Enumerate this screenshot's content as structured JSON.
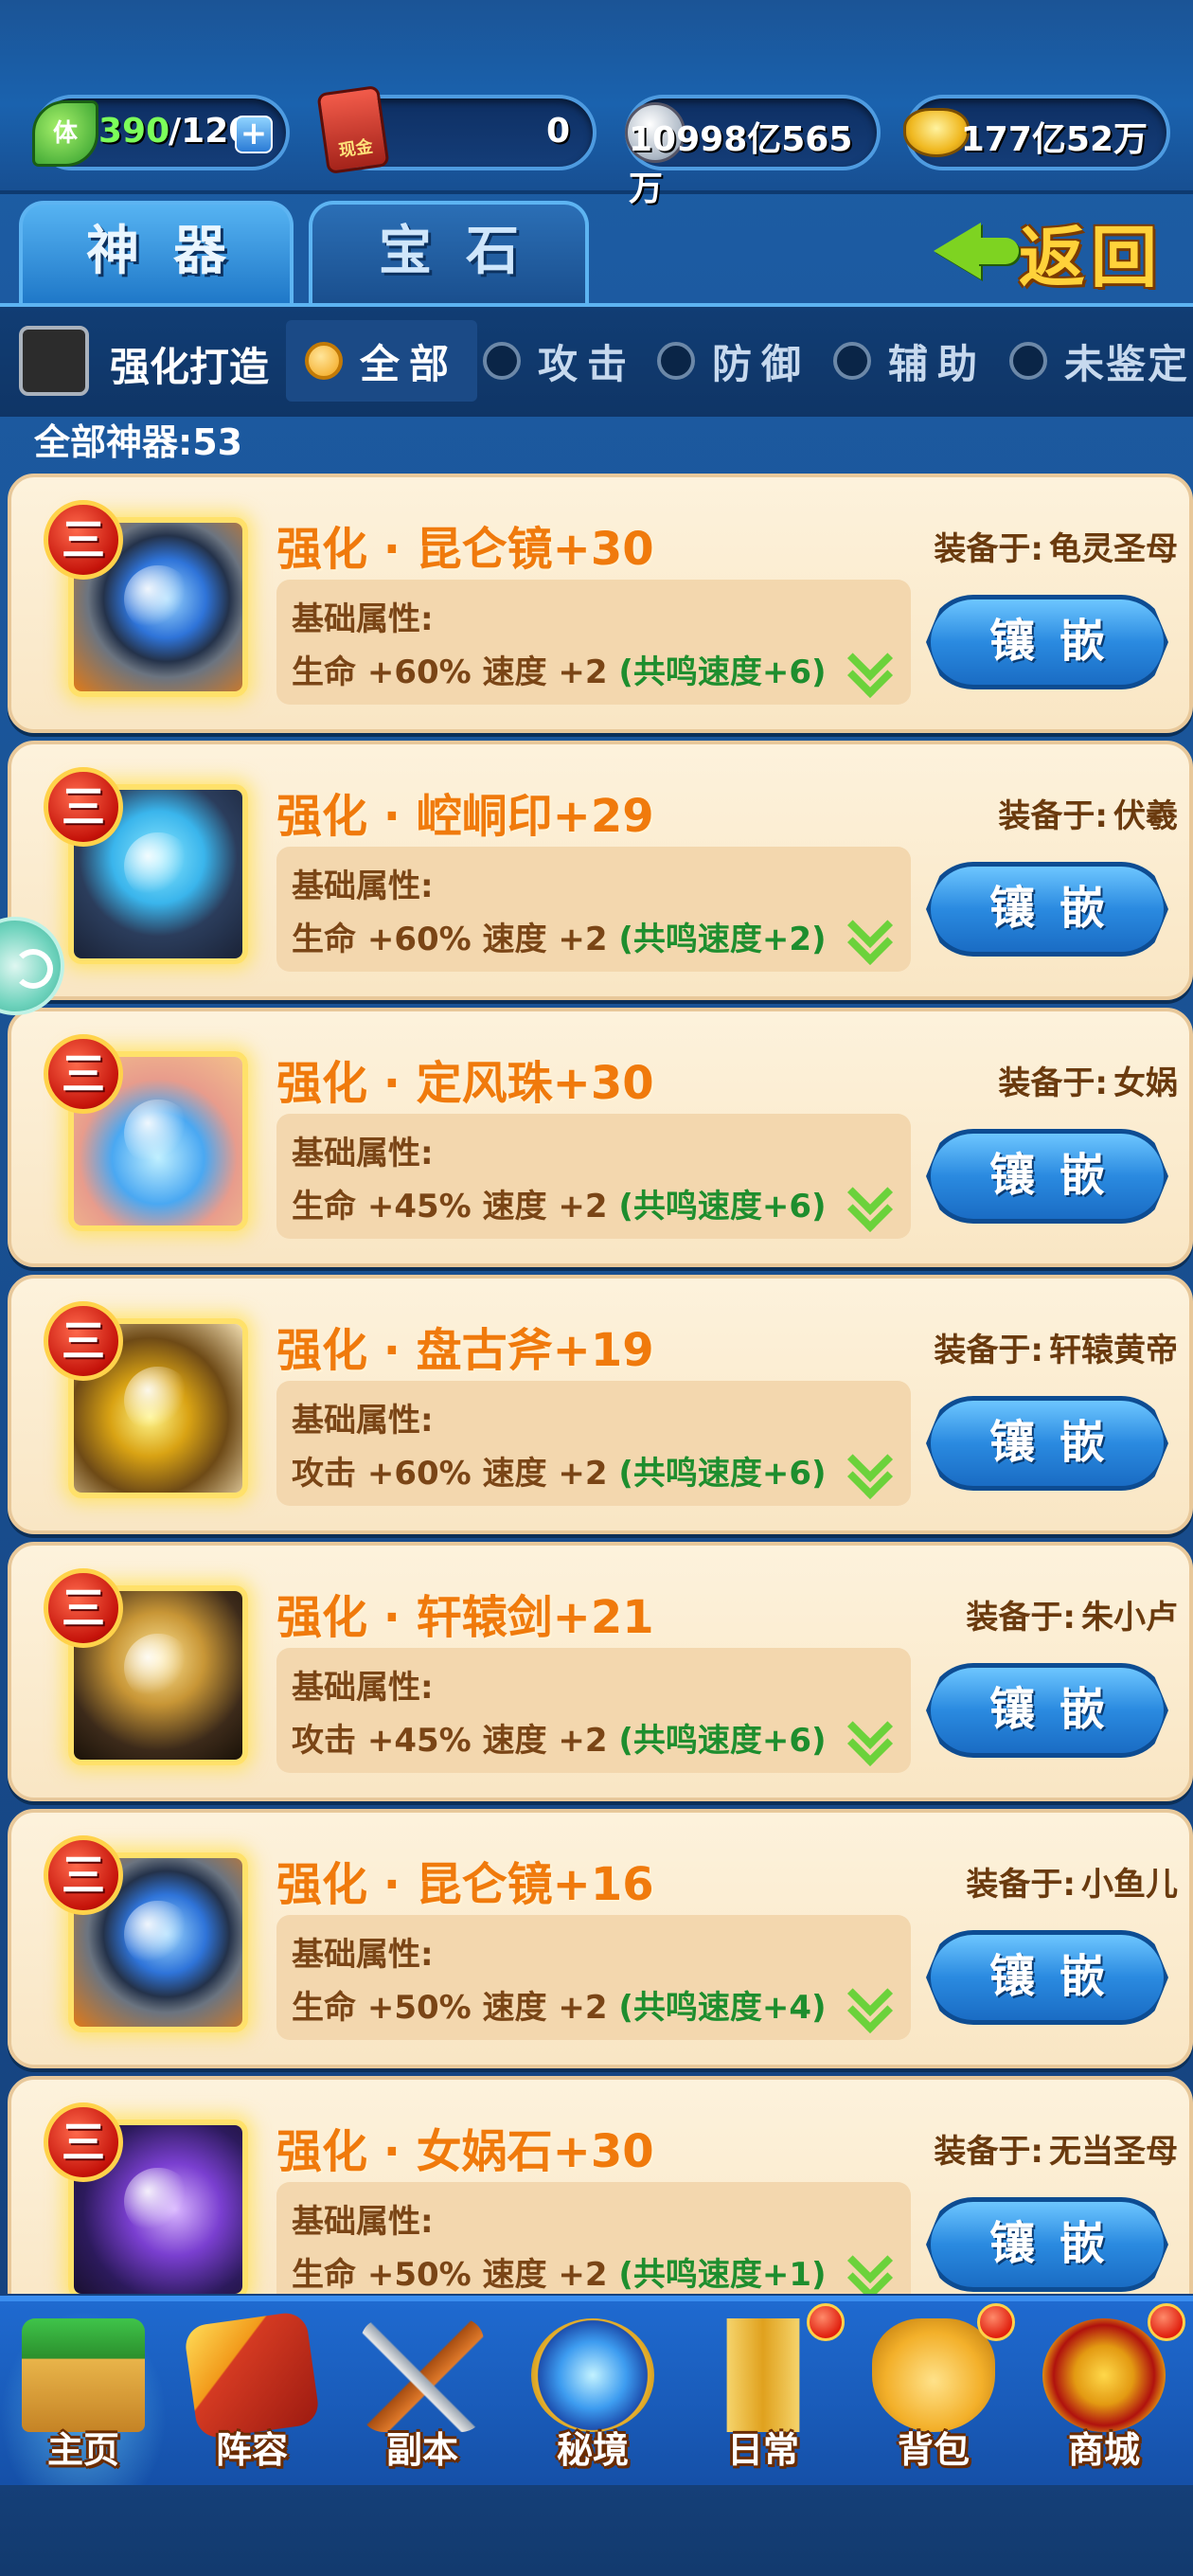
{
  "resources": {
    "stamina_icon_text": "体",
    "stamina_current": "390",
    "stamina_max": "/120",
    "cash_icon_text": "现金",
    "cash_value": "0",
    "silver_value": "10998亿565万",
    "gold_value": "177亿52万"
  },
  "tabs": [
    {
      "label": "神器",
      "active": true
    },
    {
      "label": "宝石",
      "active": false
    }
  ],
  "back_label": "返回",
  "filters": {
    "enhance_forge_label": "强化打造",
    "enhance_forge_checked": false,
    "options": [
      {
        "label": "全部",
        "selected": true
      },
      {
        "label": "攻击",
        "selected": false
      },
      {
        "label": "防御",
        "selected": false
      },
      {
        "label": "辅助",
        "selected": false
      },
      {
        "label": "未鉴定",
        "selected": false
      }
    ]
  },
  "count_label": "全部神器:53",
  "items": [
    {
      "tier": "三",
      "icon": "mirror-icon",
      "name": "强化 · 昆仑镜+30",
      "equip_label": "装备于:",
      "equip_target": "龟灵圣母",
      "attr_title": "基础属性:",
      "attr_values": "生命 +60%  速度 +2 ",
      "resonance": "(共鸣速度+6)",
      "button": "镶嵌"
    },
    {
      "tier": "三",
      "icon": "seal-icon",
      "name": "强化 · 崆峒印+29",
      "equip_label": "装备于:",
      "equip_target": "伏羲",
      "attr_title": "基础属性:",
      "attr_values": "生命 +60%  速度 +2 ",
      "resonance": "(共鸣速度+2)",
      "button": "镶嵌"
    },
    {
      "tier": "三",
      "icon": "pearl-icon",
      "name": "强化 · 定风珠+30",
      "equip_label": "装备于:",
      "equip_target": "女娲",
      "attr_title": "基础属性:",
      "attr_values": "生命 +45%  速度 +2 ",
      "resonance": "(共鸣速度+6)",
      "button": "镶嵌"
    },
    {
      "tier": "三",
      "icon": "axe-icon",
      "name": "强化 · 盘古斧+19",
      "equip_label": "装备于:",
      "equip_target": "轩辕黄帝",
      "attr_title": "基础属性:",
      "attr_values": "攻击 +60%  速度 +2 ",
      "resonance": "(共鸣速度+6)",
      "button": "镶嵌"
    },
    {
      "tier": "三",
      "icon": "sword-icon",
      "name": "强化 · 轩辕剑+21",
      "equip_label": "装备于:",
      "equip_target": "朱小卢",
      "attr_title": "基础属性:",
      "attr_values": "攻击 +45%  速度 +2 ",
      "resonance": "(共鸣速度+6)",
      "button": "镶嵌"
    },
    {
      "tier": "三",
      "icon": "mirror-icon",
      "name": "强化 · 昆仑镜+16",
      "equip_label": "装备于:",
      "equip_target": "小鱼儿",
      "attr_title": "基础属性:",
      "attr_values": "生命 +50%  速度 +2 ",
      "resonance": "(共鸣速度+4)",
      "button": "镶嵌"
    },
    {
      "tier": "三",
      "icon": "stone-icon",
      "name": "强化 · 女娲石+30",
      "equip_label": "装备于:",
      "equip_target": "无当圣母",
      "attr_title": "基础属性:",
      "attr_values": "生命 +50%  速度 +2 ",
      "resonance": "(共鸣速度+1)",
      "button": "镶嵌"
    }
  ],
  "nav": [
    {
      "label": "主页",
      "icon": "home-icon",
      "active": true,
      "badge": false
    },
    {
      "label": "阵容",
      "icon": "lineup-icon",
      "active": false,
      "badge": false
    },
    {
      "label": "副本",
      "icon": "dungeon-icon",
      "active": false,
      "badge": false
    },
    {
      "label": "秘境",
      "icon": "secret-realm-icon",
      "active": false,
      "badge": false
    },
    {
      "label": "日常",
      "icon": "daily-icon",
      "active": false,
      "badge": true
    },
    {
      "label": "背包",
      "icon": "bag-icon",
      "active": false,
      "badge": true
    },
    {
      "label": "商城",
      "icon": "shop-icon",
      "active": false,
      "badge": true
    }
  ]
}
